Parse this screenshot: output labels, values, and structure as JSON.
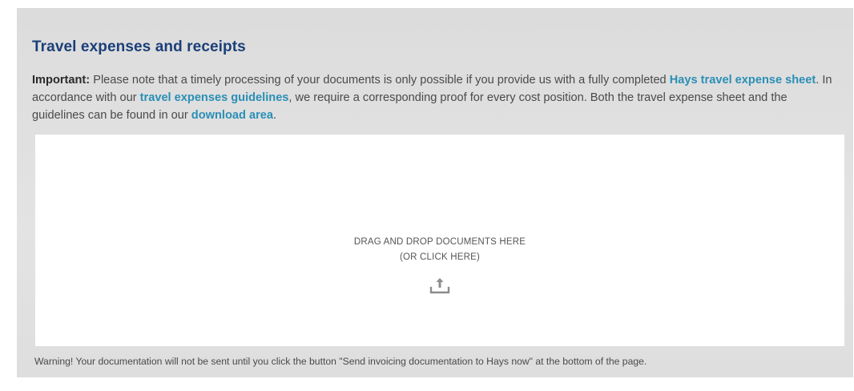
{
  "section": {
    "title": "Travel expenses and receipts"
  },
  "intro": {
    "important_label": "Important:",
    "text_1": " Please note that a timely processing of your documents is only possible if you provide us with a fully completed ",
    "link_expense_sheet": "Hays travel expense sheet",
    "text_2": ". In accordance with our ",
    "link_guidelines": "travel expenses guidelines",
    "text_3": ", we require a corresponding proof for every cost position. Both the travel expense sheet and the guidelines can be found in our ",
    "link_download_area": "download area",
    "text_4": "."
  },
  "dropzone": {
    "line_1": "DRAG AND DROP DOCUMENTS HERE",
    "line_2": "(OR CLICK HERE)",
    "icon": "upload-icon"
  },
  "warning": {
    "text": "Warning! Your documentation will not be sent until you click the button \"Send invoicing documentation to Hays now\" at the bottom of the page."
  },
  "colors": {
    "title": "#1b3f78",
    "link": "#2a8fb5",
    "panel_background": "#e0e0e0",
    "body_text": "#4a4a4a"
  }
}
